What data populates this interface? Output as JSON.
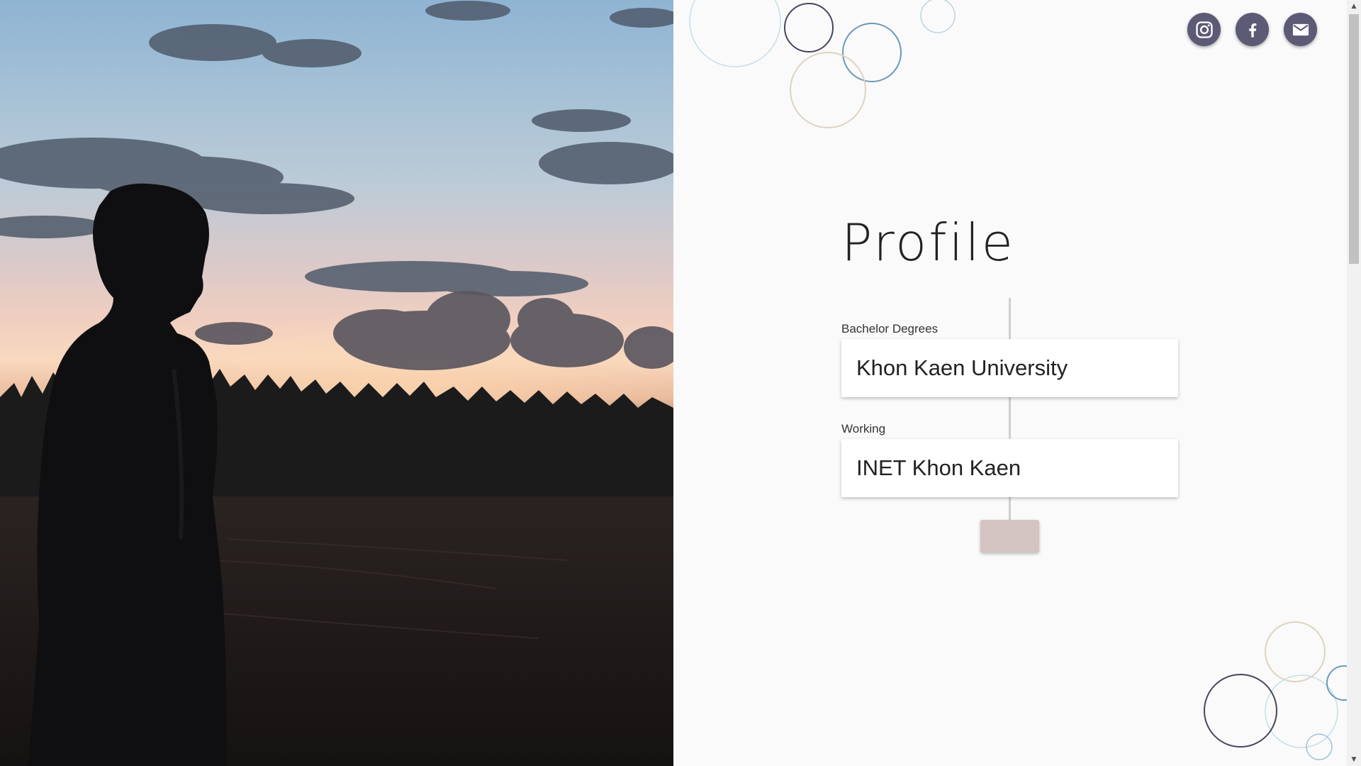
{
  "photo": {
    "description_icon": "sunset-silhouette-photo"
  },
  "social": [
    {
      "name": "instagram",
      "icon": "instagram-icon"
    },
    {
      "name": "facebook",
      "icon": "facebook-icon"
    },
    {
      "name": "email",
      "icon": "mail-icon"
    }
  ],
  "profile": {
    "title": "Profile",
    "entries": [
      {
        "label": "Bachelor Degrees",
        "value": "Khon Kaen University"
      },
      {
        "label": "Working",
        "value": "INET Khon Kaen"
      }
    ]
  },
  "colors": {
    "social_bg": "#5d5a76",
    "end_button": "#d4c4c2",
    "circle_blue": "#5b8fb0",
    "circle_navy": "#48465f",
    "circle_beige": "#d8cebc",
    "circle_light_blue": "#b9d3e0"
  }
}
